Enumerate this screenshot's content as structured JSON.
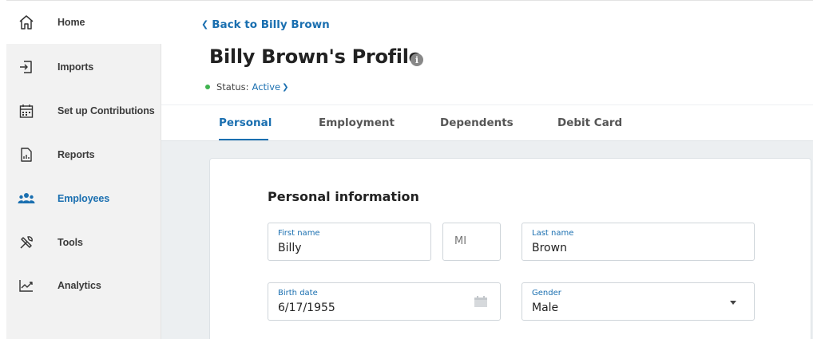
{
  "sidebar": {
    "items": [
      {
        "label": "Home",
        "icon": "home-icon"
      },
      {
        "label": "Imports",
        "icon": "import-icon"
      },
      {
        "label": "Set up Contributions",
        "icon": "calendar-icon"
      },
      {
        "label": "Reports",
        "icon": "report-icon"
      },
      {
        "label": "Employees",
        "icon": "people-icon"
      },
      {
        "label": "Tools",
        "icon": "tools-icon"
      },
      {
        "label": "Analytics",
        "icon": "chart-icon"
      }
    ],
    "selected": "Employees"
  },
  "header": {
    "back_link": "Back to Billy Brown",
    "title": "Billy Brown's Profile",
    "status_label": "Status:",
    "status_value": "Active"
  },
  "tabs": [
    {
      "label": "Personal",
      "active": true
    },
    {
      "label": "Employment",
      "active": false
    },
    {
      "label": "Dependents",
      "active": false
    },
    {
      "label": "Debit Card",
      "active": false
    }
  ],
  "form": {
    "section_title": "Personal information",
    "first_name": {
      "label": "First name",
      "value": "Billy"
    },
    "middle_initial": {
      "placeholder": "MI"
    },
    "last_name": {
      "label": "Last name",
      "value": "Brown"
    },
    "birth_date": {
      "label": "Birth date",
      "value": "6/17/1955"
    },
    "gender": {
      "label": "Gender",
      "value": "Male"
    }
  },
  "colors": {
    "accent": "#1a6fb0",
    "status_active": "#3fb34f",
    "sidebar_bg": "#f2f2f2",
    "content_bg": "#eceff1"
  }
}
